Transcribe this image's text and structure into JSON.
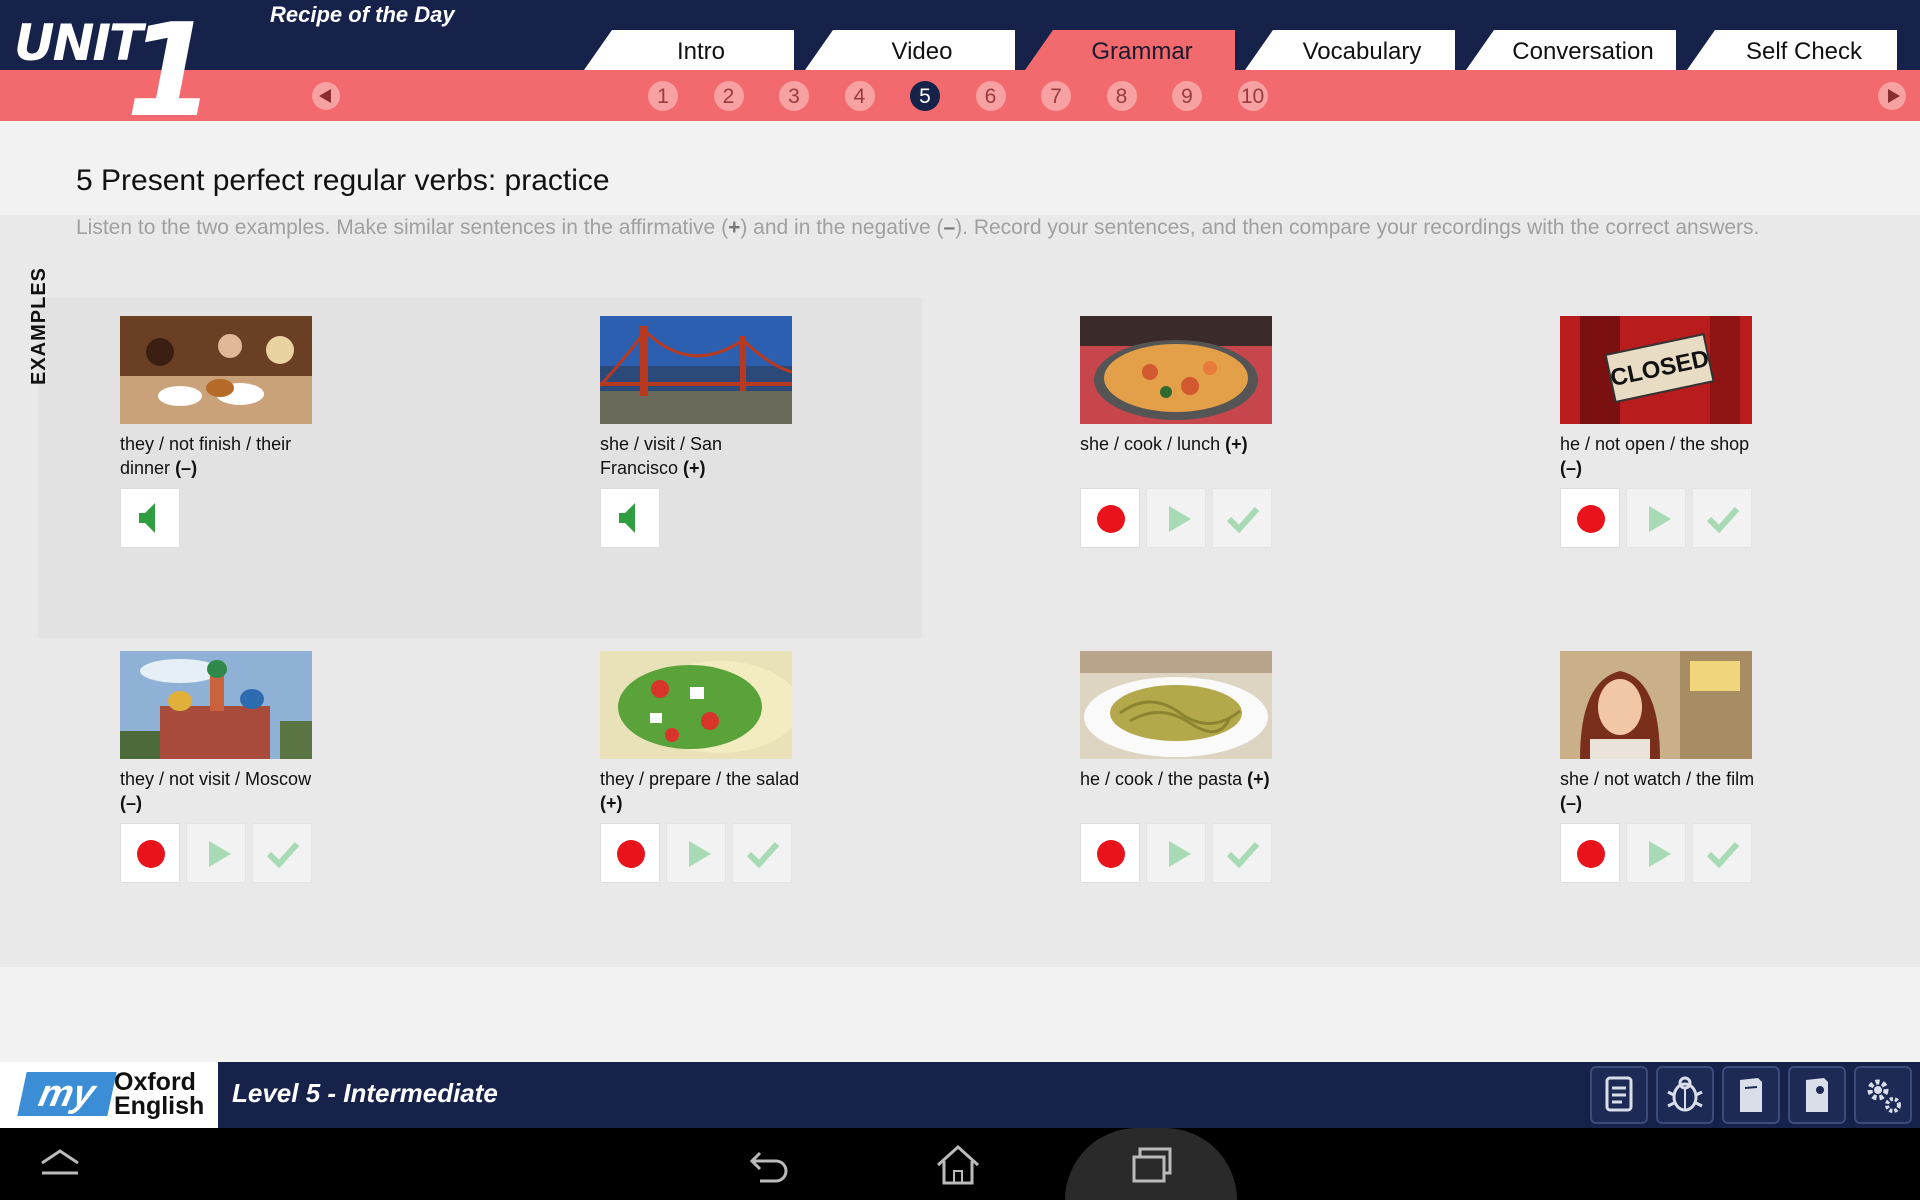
{
  "header": {
    "unit_word": "UNIT",
    "unit_number": "1",
    "subtitle": "Recipe of the Day",
    "tabs": [
      {
        "label": "Intro",
        "active": false
      },
      {
        "label": "Video",
        "active": false
      },
      {
        "label": "Grammar",
        "active": true
      },
      {
        "label": "Vocabulary",
        "active": false
      },
      {
        "label": "Conversation",
        "active": false
      },
      {
        "label": "Self Check",
        "active": false
      }
    ],
    "pages": [
      "1",
      "2",
      "3",
      "4",
      "5",
      "6",
      "7",
      "8",
      "9",
      "10"
    ],
    "current_page": "5"
  },
  "exercise": {
    "title": "5 Present perfect regular verbs: practice",
    "instructions_a": "Listen to the two examples. Make similar sentences in the affirmative (",
    "plus": "+",
    "instructions_b": ") and in the negative (",
    "minus": "–",
    "instructions_c": "). Record your sentences, and then compare your recordings with the correct answers.",
    "examples_label": "EXAMPLES",
    "items": [
      {
        "text": "they / not finish / their dinner",
        "sign": "(–)",
        "type": "example",
        "image": "family-dinner"
      },
      {
        "text": "she / visit / San Francisco",
        "sign": "(+)",
        "type": "example",
        "image": "golden-gate-bridge"
      },
      {
        "text": "she / cook / lunch",
        "sign": "(+)",
        "type": "practice",
        "image": "paella"
      },
      {
        "text": "he / not open / the shop",
        "sign": "(–)",
        "type": "practice",
        "image": "closed-sign"
      },
      {
        "text": "they / not visit / Moscow",
        "sign": "(–)",
        "type": "practice",
        "image": "moscow-cathedral"
      },
      {
        "text": "they / prepare / the salad",
        "sign": "(+)",
        "type": "practice",
        "image": "salad"
      },
      {
        "text": "he / cook / the pasta",
        "sign": "(+)",
        "type": "practice",
        "image": "pasta"
      },
      {
        "text": "she / not watch / the film",
        "sign": "(–)",
        "type": "practice",
        "image": "woman-cinema"
      }
    ]
  },
  "footer": {
    "logo_my": "my",
    "logo_oxford": "Oxford",
    "logo_english": "English",
    "level": "Level 5 - Intermediate",
    "tools": [
      "document-icon",
      "bug-icon",
      "notebook-icon",
      "phrasebook-icon",
      "settings-icon"
    ]
  },
  "colors": {
    "navy": "#16224a",
    "coral": "#f26a6d",
    "record": "#e8131b",
    "speaker": "#2e9e3e",
    "disabled_green": "#a8dbb5"
  }
}
